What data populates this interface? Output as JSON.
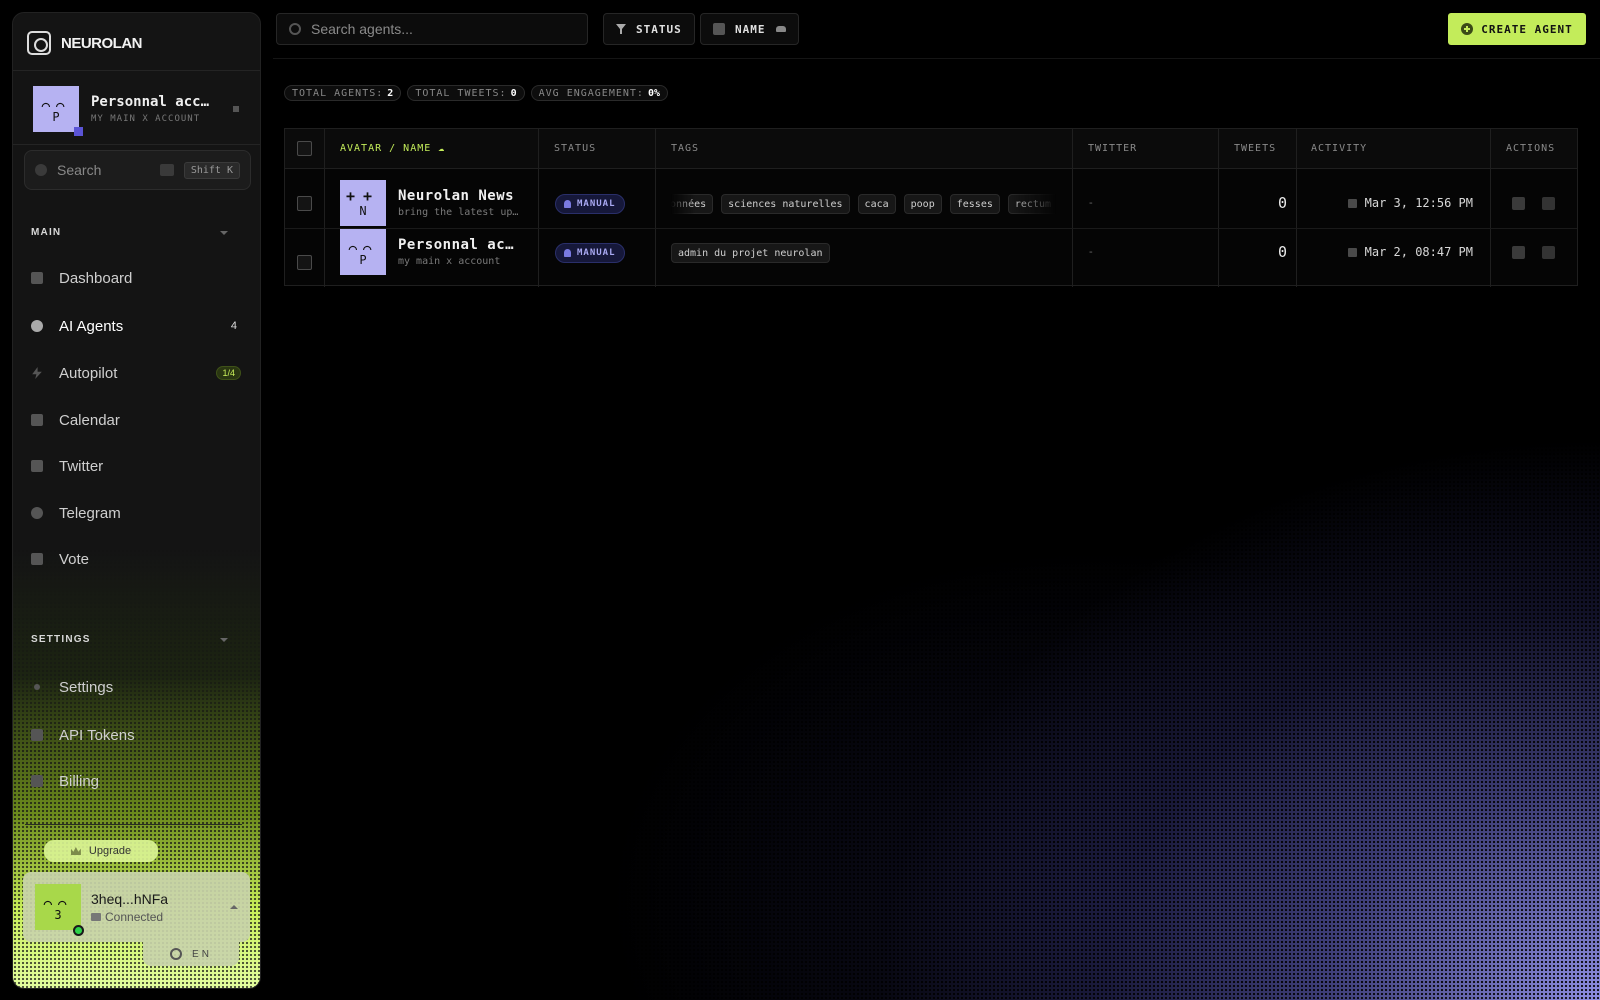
{
  "brand": {
    "name": "NEUROLAN"
  },
  "account": {
    "name": "Personnal account",
    "subtitle": "MY MAIN X ACCOUNT",
    "avatar_eyes": "⌒⌒",
    "avatar_initial": "P"
  },
  "sidebar_search": {
    "label": "Search",
    "shortcut": "Shift K"
  },
  "sections": {
    "main": "MAIN",
    "settings": "SETTINGS"
  },
  "nav_main": [
    {
      "label": "Dashboard",
      "icon": "home-icon"
    },
    {
      "label": "AI Agents",
      "icon": "bot-icon",
      "count": "4"
    },
    {
      "label": "Autopilot",
      "icon": "bolt-icon",
      "pill": "1/4"
    },
    {
      "label": "Calendar",
      "icon": "calendar-icon"
    },
    {
      "label": "Twitter",
      "icon": "twitter-icon"
    },
    {
      "label": "Telegram",
      "icon": "telegram-icon"
    },
    {
      "label": "Vote",
      "icon": "vote-icon"
    }
  ],
  "nav_settings": [
    {
      "label": "Settings",
      "icon": "gear-icon"
    },
    {
      "label": "API Tokens",
      "icon": "grid-icon"
    },
    {
      "label": "Billing",
      "icon": "card-icon"
    }
  ],
  "upgrade": {
    "label": "Upgrade"
  },
  "wallet": {
    "address": "3heq...hNFa",
    "status": "Connected",
    "avatar_initial": "3"
  },
  "language": {
    "code": "EN"
  },
  "topbar": {
    "search_placeholder": "Search agents...",
    "status_filter": "STATUS",
    "name_sort": "NAME",
    "create_label": "CREATE AGENT"
  },
  "stats": [
    {
      "label": "TOTAL AGENTS:",
      "value": "2"
    },
    {
      "label": "TOTAL TWEETS:",
      "value": "0"
    },
    {
      "label": "AVG ENGAGEMENT:",
      "value": "0%"
    }
  ],
  "table": {
    "columns": [
      "AVATAR / NAME ☁",
      "STATUS",
      "TAGS",
      "TWITTER",
      "TWEETS",
      "ACTIVITY",
      "ACTIONS"
    ],
    "rows": [
      {
        "name": "Neurolan News",
        "desc": "bring the latest updates",
        "avatar_initial": "N",
        "avatar_eyes": "++",
        "status": "MANUAL",
        "tags": [
          "données",
          "sciences naturelles",
          "caca",
          "poop",
          "fesses",
          "rectum"
        ],
        "twitter": "-",
        "tweets": "0",
        "activity": "Mar 3, 12:56 PM"
      },
      {
        "name": "Personnal account",
        "desc": "my main x account",
        "avatar_initial": "P",
        "avatar_eyes": "⌒⌒",
        "status": "MANUAL",
        "tags": [
          "admin du projet neurolan"
        ],
        "twitter": "-",
        "tweets": "0",
        "activity": "Mar 2, 08:47 PM"
      }
    ]
  },
  "colors": {
    "accent": "#c3ec5a",
    "avatar_purple": "#b6b2f2",
    "status_blue": "#a9a9f2"
  }
}
